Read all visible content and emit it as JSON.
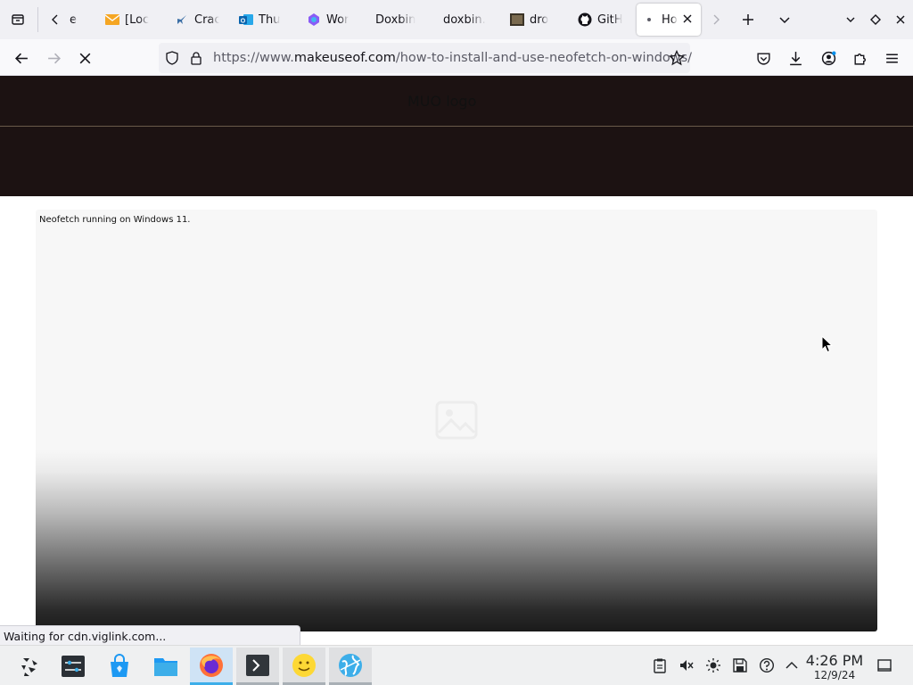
{
  "browser": {
    "tabs": [
      {
        "label": "e",
        "icon": "generic-page-icon"
      },
      {
        "label": "[Loc",
        "icon": "mail-icon"
      },
      {
        "label": "Crac",
        "icon": "rocket-icon"
      },
      {
        "label": "Thư",
        "icon": "outlook-icon"
      },
      {
        "label": "Wor",
        "icon": "copilot-icon"
      },
      {
        "label": "Doxbin",
        "icon": "none"
      },
      {
        "label": "doxbin.",
        "icon": "none"
      },
      {
        "label": "dro",
        "icon": "image-favicon-icon"
      },
      {
        "label": "GitH",
        "icon": "github-icon"
      },
      {
        "label": "Ho",
        "icon": "loading-dot-icon"
      }
    ],
    "url": {
      "prefix": "https://www.",
      "domain": "makeuseof.com",
      "path": "/how-to-install-and-use-neofetch-on-windows/"
    }
  },
  "page": {
    "logo_alt": "MUO logo",
    "caption": "Neofetch running on Windows 11.",
    "status": "Waiting for cdn.viglink.com...",
    "colors": {
      "header_bg": "#1c1212",
      "accent": "#3daee9"
    }
  },
  "taskbar": {
    "time": "4:26 PM",
    "date": "12/9/24"
  }
}
